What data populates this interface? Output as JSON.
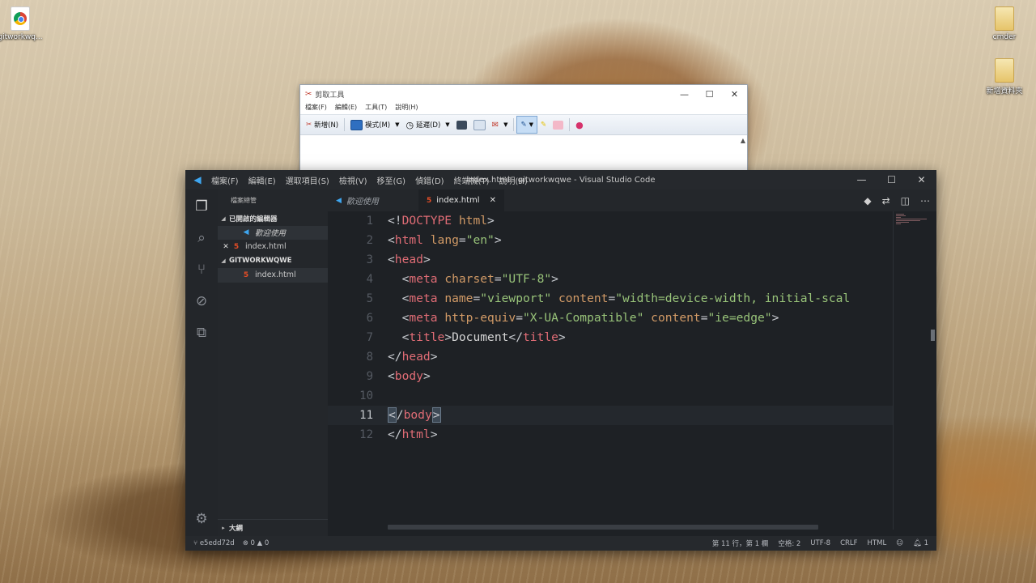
{
  "desktop": {
    "icons": [
      {
        "label": "gitworkwq..."
      },
      {
        "label": "cmder"
      },
      {
        "label": "新增資料夾"
      }
    ]
  },
  "snipping_tool": {
    "title": "剪取工具",
    "window_controls": [
      "—",
      "☐",
      "✕"
    ],
    "menu": [
      "檔案(F)",
      "編輯(E)",
      "工具(T)",
      "說明(H)"
    ],
    "toolbar": {
      "new": "新增(N)",
      "mode": "模式(M)",
      "delay": "延遲(D)"
    },
    "scroll_arrow": "▲"
  },
  "vscode": {
    "logo": "◀",
    "menu": [
      "檔案(F)",
      "編輯(E)",
      "選取項目(S)",
      "檢視(V)",
      "移至(G)",
      "偵錯(D)",
      "終端機(T)",
      "說明(H)"
    ],
    "window_title": "index.html - gitworkwqwe - Visual Studio Code",
    "window_controls": [
      "—",
      "☐",
      "✕"
    ],
    "sidebar": {
      "header": "檔案總管",
      "open_editors_label": "已開啟的編輯器",
      "open_editors": [
        {
          "label": "歡迎使用",
          "italic": true,
          "icon": "vscode-icon"
        },
        {
          "label": "index.html",
          "icon": "html5-icon",
          "close": "✕"
        }
      ],
      "folder_label": "GITWORKWQWE",
      "folder_files": [
        {
          "label": "index.html",
          "icon": "html5-icon"
        }
      ],
      "outline_label": "大綱"
    },
    "tabs": [
      {
        "label": "歡迎使用",
        "active": false
      },
      {
        "label": "index.html",
        "active": true,
        "close": "✕"
      }
    ],
    "editor": {
      "line_numbers": [
        "1",
        "2",
        "3",
        "4",
        "5",
        "6",
        "7",
        "8",
        "9",
        "10",
        "11",
        "12"
      ],
      "current_line": 11
    },
    "status": {
      "branch": "e5edd72d",
      "errors": "0",
      "warnings": "0",
      "position": "第 11 行，第 1 欄",
      "spaces": "空格: 2",
      "encoding": "UTF-8",
      "eol": "CRLF",
      "language": "HTML",
      "notifications": "1"
    },
    "colors": {
      "tag": "#e06c75",
      "attribute": "#d19a66",
      "string": "#98c379",
      "background": "#1e2125"
    }
  }
}
